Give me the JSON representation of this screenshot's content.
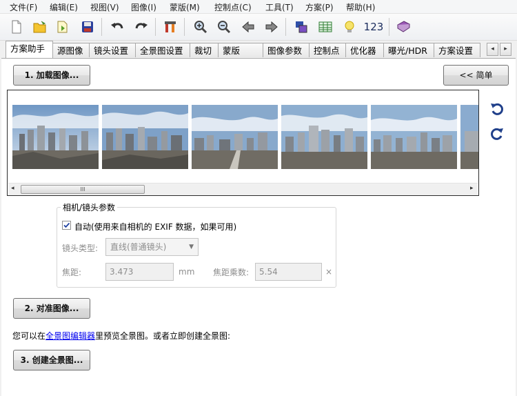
{
  "menu": [
    "文件(F)",
    "编辑(E)",
    "视图(V)",
    "图像(I)",
    "蒙版(M)",
    "控制点(C)",
    "工具(T)",
    "方案(P)",
    "帮助(H)"
  ],
  "toolbar": {
    "icons": [
      "new-file-icon",
      "open-folder-icon",
      "open-recent-icon",
      "save-icon",
      "undo-icon",
      "redo-icon",
      "tools-icon",
      "zoom-in-icon",
      "zoom-out-icon",
      "arrow-left-icon",
      "arrow-right-icon",
      "preview-icon",
      "table-icon",
      "bulb-icon",
      "numbers-icon",
      "help-book-icon"
    ],
    "numbers_label": "123"
  },
  "tabs": [
    "方案助手",
    "源图像",
    "镜头设置",
    "全景图设置",
    "裁切",
    "蒙版",
    "图像参数",
    "控制点",
    "优化器",
    "曝光/HDR",
    "方案设置"
  ],
  "active_tab": "方案助手",
  "buttons": {
    "load_images": "1. 加载图像...",
    "simple": "<< 简单",
    "align_images": "2. 对准图像...",
    "create_panorama": "3. 创建全景图..."
  },
  "scrollbar": {
    "left_arrow": "◂",
    "right_arrow": "▸",
    "grip": "III"
  },
  "camera_lens": {
    "title": "相机/镜头参数",
    "auto_checked": true,
    "auto_label": "自动(使用来自相机的 EXIF 数据，如果可用)",
    "lens_type_label": "镜头类型:",
    "lens_type_value": "直线(普通镜头)",
    "focal_length_label": "焦距:",
    "focal_length_value": "3.473",
    "focal_length_unit": "mm",
    "crop_factor_label": "焦距乘数:",
    "crop_factor_value": "5.54",
    "crop_factor_unit": "×"
  },
  "info": {
    "prefix": "您可以在",
    "link": "全景图编辑器",
    "suffix": "里预览全景图。或者立即创建全景图:"
  }
}
